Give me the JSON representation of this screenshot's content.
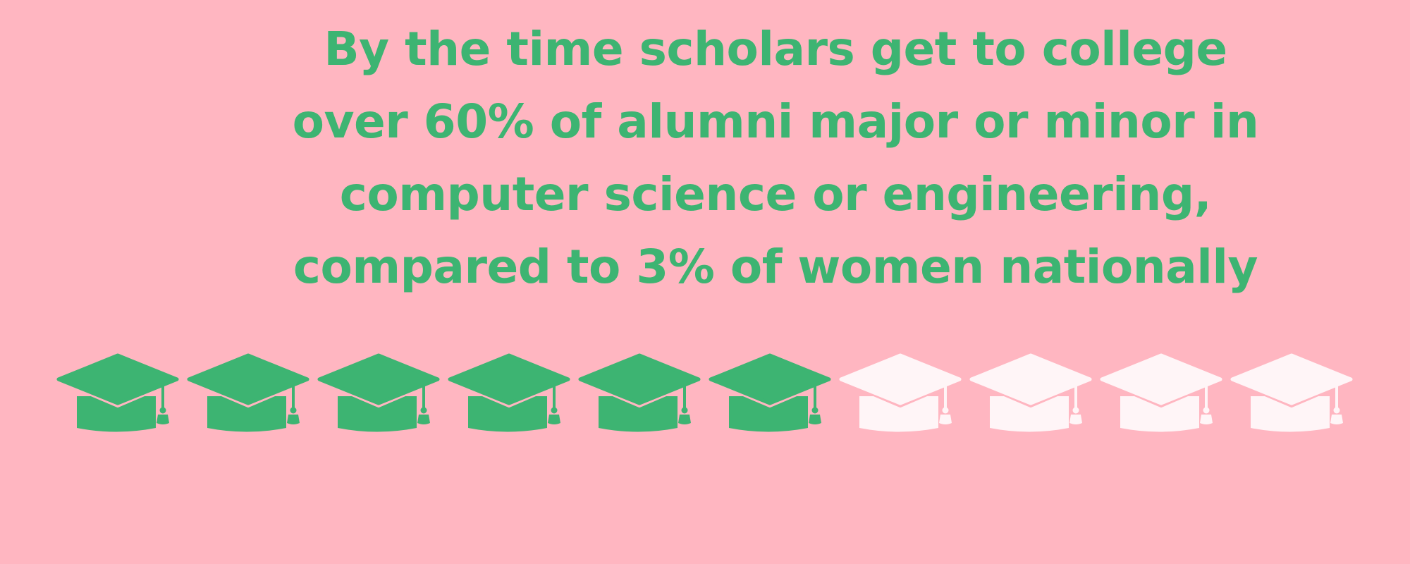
{
  "headline": {
    "lines": [
      "By the time scholars get to college",
      "over 60% of alumni major or minor in",
      "computer science or engineering,",
      "compared to 3% of women nationally"
    ]
  },
  "pictogram": {
    "icon": "graduation-cap-icon",
    "total": 10,
    "filled": 6,
    "filled_color": "#3DB472",
    "empty_color": "#FFF5F7"
  },
  "colors": {
    "background": "#FFB6C1",
    "text": "#3DB472"
  }
}
